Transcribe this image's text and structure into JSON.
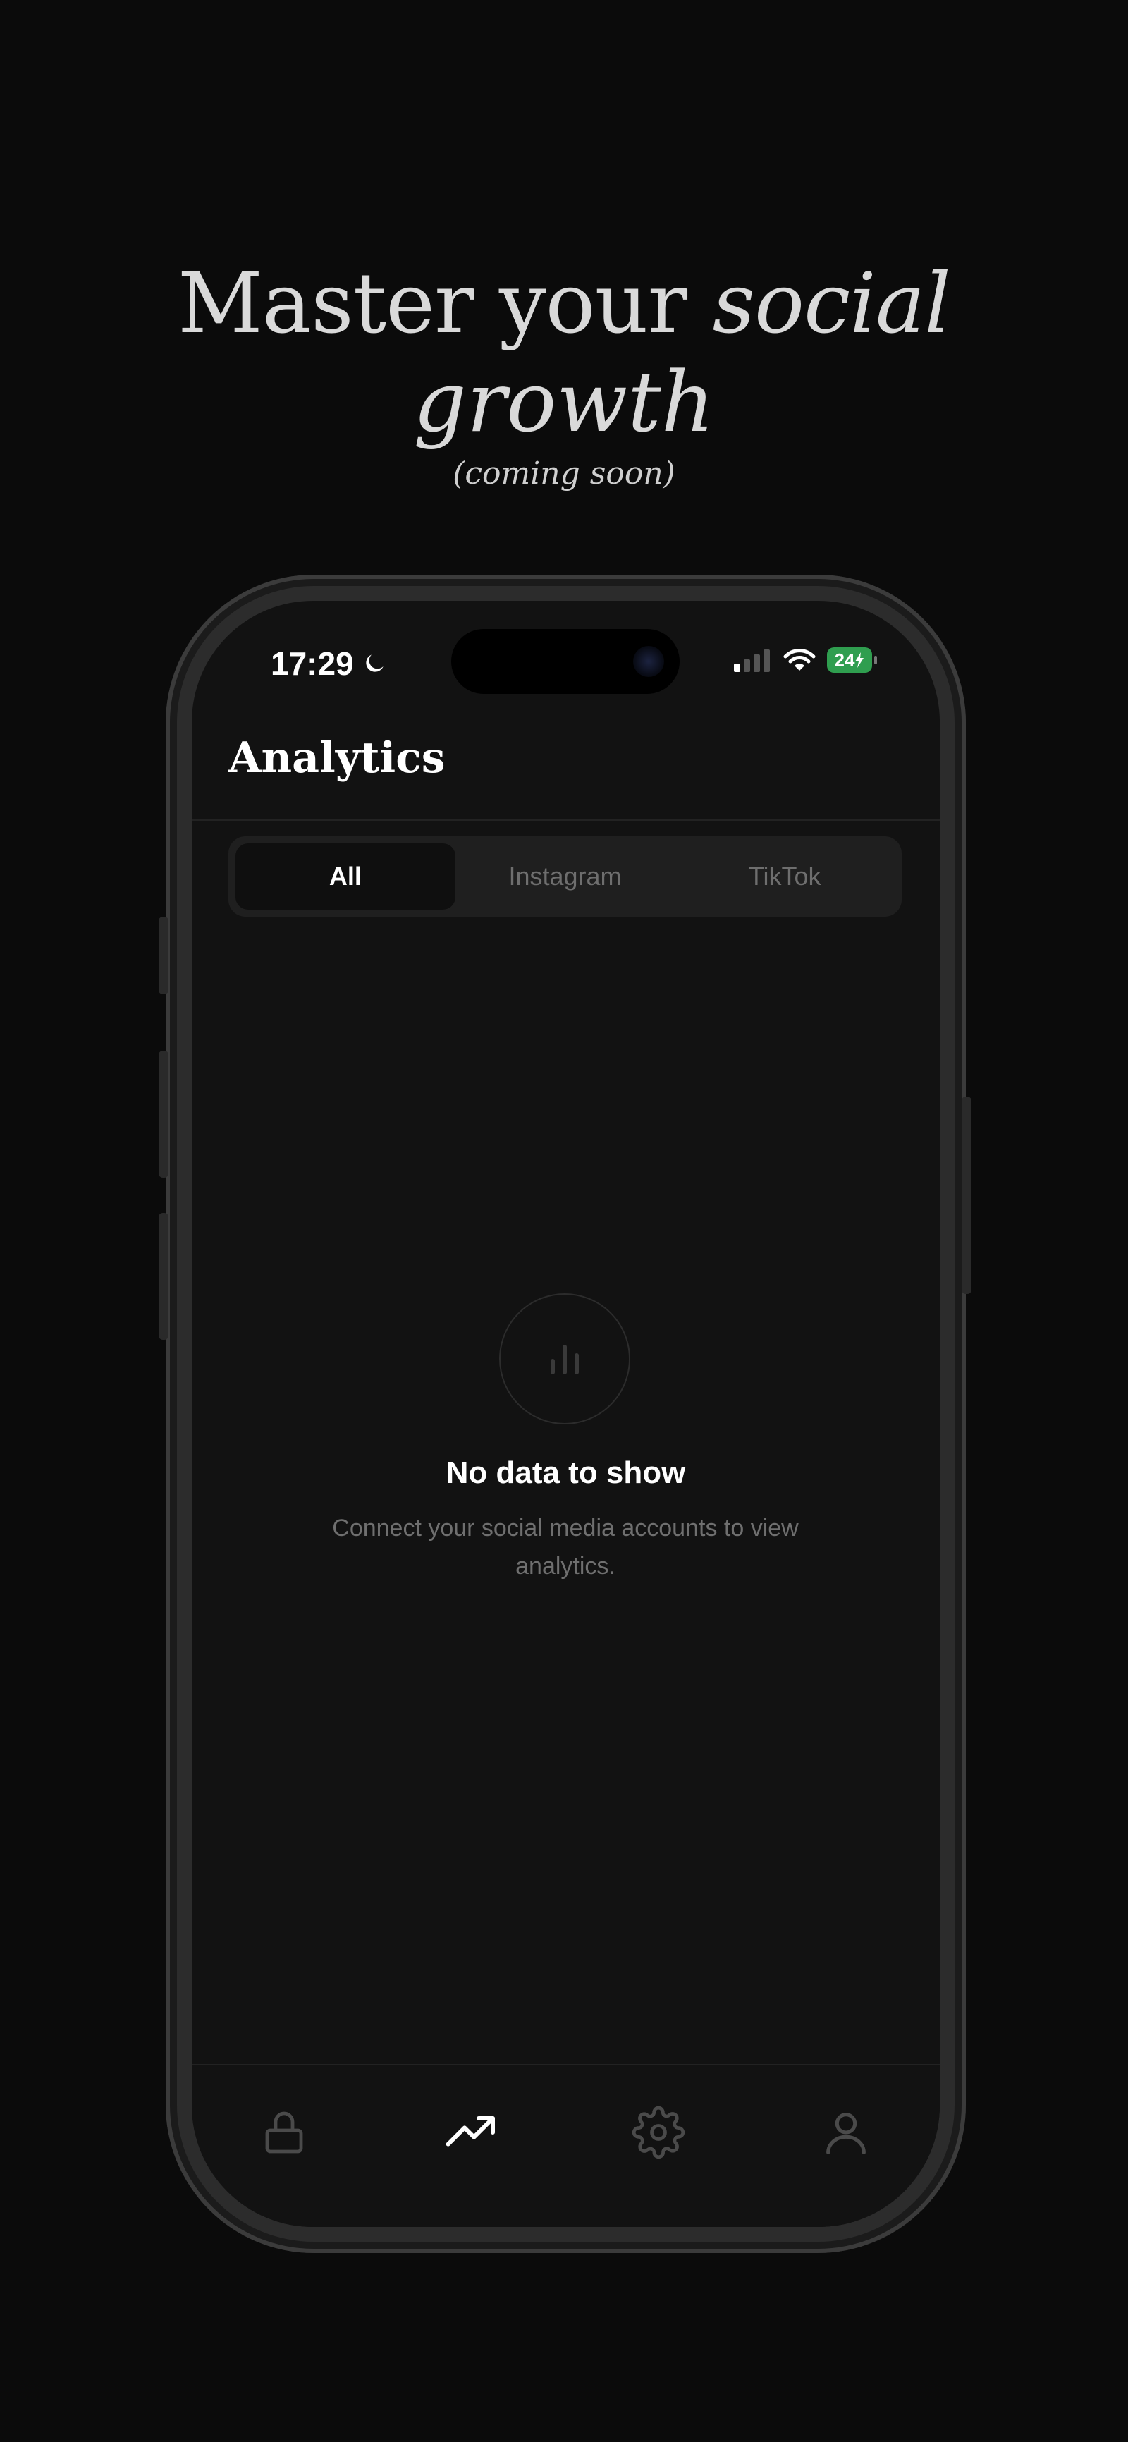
{
  "headline": {
    "line1_plain": "Master your ",
    "line1_italic": "social",
    "line2_italic": "growth",
    "subtitle": "(coming soon)"
  },
  "status_bar": {
    "time": "17:29",
    "moon_icon": "moon-icon",
    "battery_level": "24"
  },
  "app": {
    "title": "Analytics",
    "tabs": [
      {
        "label": "All",
        "active": true
      },
      {
        "label": "Instagram",
        "active": false
      },
      {
        "label": "TikTok",
        "active": false
      }
    ],
    "empty_state": {
      "icon": "bar-chart-icon",
      "title": "No data to show",
      "description": "Connect your social media accounts to view analytics."
    },
    "bottom_nav": [
      {
        "icon": "lock-icon",
        "active": false
      },
      {
        "icon": "trending-up-icon",
        "active": true
      },
      {
        "icon": "gear-icon",
        "active": false
      },
      {
        "icon": "user-icon",
        "active": false
      }
    ]
  },
  "colors": {
    "background": "#0b0b0b",
    "screen": "#121212",
    "battery": "#2f9e4f",
    "muted_text": "#6f6f6f"
  }
}
